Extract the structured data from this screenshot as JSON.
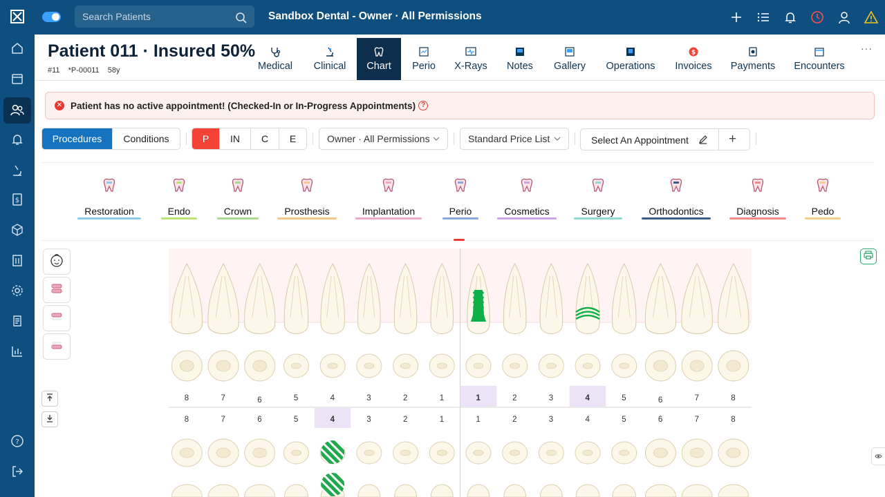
{
  "topbar": {
    "search_placeholder": "Search Patients",
    "title": "Sandbox Dental - Owner · All Permissions",
    "icons": [
      "plus-icon",
      "list-icon",
      "bell-icon",
      "clock-icon",
      "user-icon",
      "warning-icon"
    ]
  },
  "sidebar": {
    "items": [
      "home-icon",
      "calendar-icon",
      "patients-icon",
      "notifications-icon",
      "microscope-icon",
      "billing-icon",
      "inventory-icon",
      "building-icon",
      "settings-icon",
      "ledger-icon",
      "reports-icon"
    ],
    "bottom": [
      "help-icon",
      "logout-icon"
    ],
    "active_index": 2
  },
  "patient": {
    "name": "Patient 011 · Insured 50%",
    "id": "#11",
    "code": "*P-00011",
    "age": "58y"
  },
  "tabs": [
    {
      "label": "Medical"
    },
    {
      "label": "Clinical"
    },
    {
      "label": "Chart"
    },
    {
      "label": "Perio"
    },
    {
      "label": "X-Rays"
    },
    {
      "label": "Notes"
    },
    {
      "label": "Gallery"
    },
    {
      "label": "Operations"
    },
    {
      "label": "Invoices"
    },
    {
      "label": "Payments"
    },
    {
      "label": "Encounters"
    }
  ],
  "more_label": "···",
  "alert": {
    "text": "Patient has no active appointment! (Checked-In or In-Progress Appointments)",
    "help": "?"
  },
  "filters": {
    "mode": [
      "Procedures",
      "Conditions"
    ],
    "status": [
      "P",
      "IN",
      "C",
      "E"
    ],
    "provider": "Owner · All Permissions",
    "price_list": "Standard Price List",
    "appointment": "Select An Appointment",
    "add": "+"
  },
  "categories": [
    {
      "label": "Restoration",
      "color": "#8ccaf0"
    },
    {
      "label": "Endo",
      "color": "#bde27a"
    },
    {
      "label": "Crown",
      "color": "#a9d98f"
    },
    {
      "label": "Prosthesis",
      "color": "#f5c78a"
    },
    {
      "label": "Implantation",
      "color": "#f2a8c6"
    },
    {
      "label": "Perio",
      "color": "#8aa6e6"
    },
    {
      "label": "Cosmetics",
      "color": "#c9a4e8"
    },
    {
      "label": "Surgery",
      "color": "#8ed9d0"
    },
    {
      "label": "Orthodontics",
      "color": "#3d5a8a"
    },
    {
      "label": "Diagnosis",
      "color": "#ee8a8a"
    },
    {
      "label": "Pedo",
      "color": "#f5cf8a"
    }
  ],
  "teeth": {
    "upper_numbers": [
      "8",
      "7",
      "6",
      "5",
      "4",
      "3",
      "2",
      "1",
      "1",
      "2",
      "3",
      "4",
      "5",
      "6",
      "7",
      "8"
    ],
    "lower_numbers": [
      "8",
      "7",
      "6",
      "5",
      "4",
      "3",
      "2",
      "1",
      "1",
      "2",
      "3",
      "4",
      "5",
      "6",
      "7",
      "8"
    ]
  }
}
